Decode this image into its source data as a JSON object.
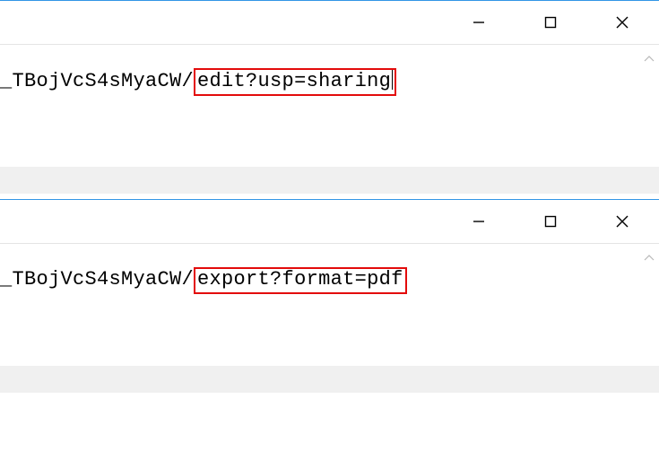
{
  "windows": [
    {
      "url_prefix": "_TBojVcS4sMyaCW/",
      "url_highlight": "edit?usp=sharing",
      "has_caret": true
    },
    {
      "url_prefix": "_TBojVcS4sMyaCW/",
      "url_highlight": "export?format=pdf",
      "has_caret": false
    }
  ]
}
